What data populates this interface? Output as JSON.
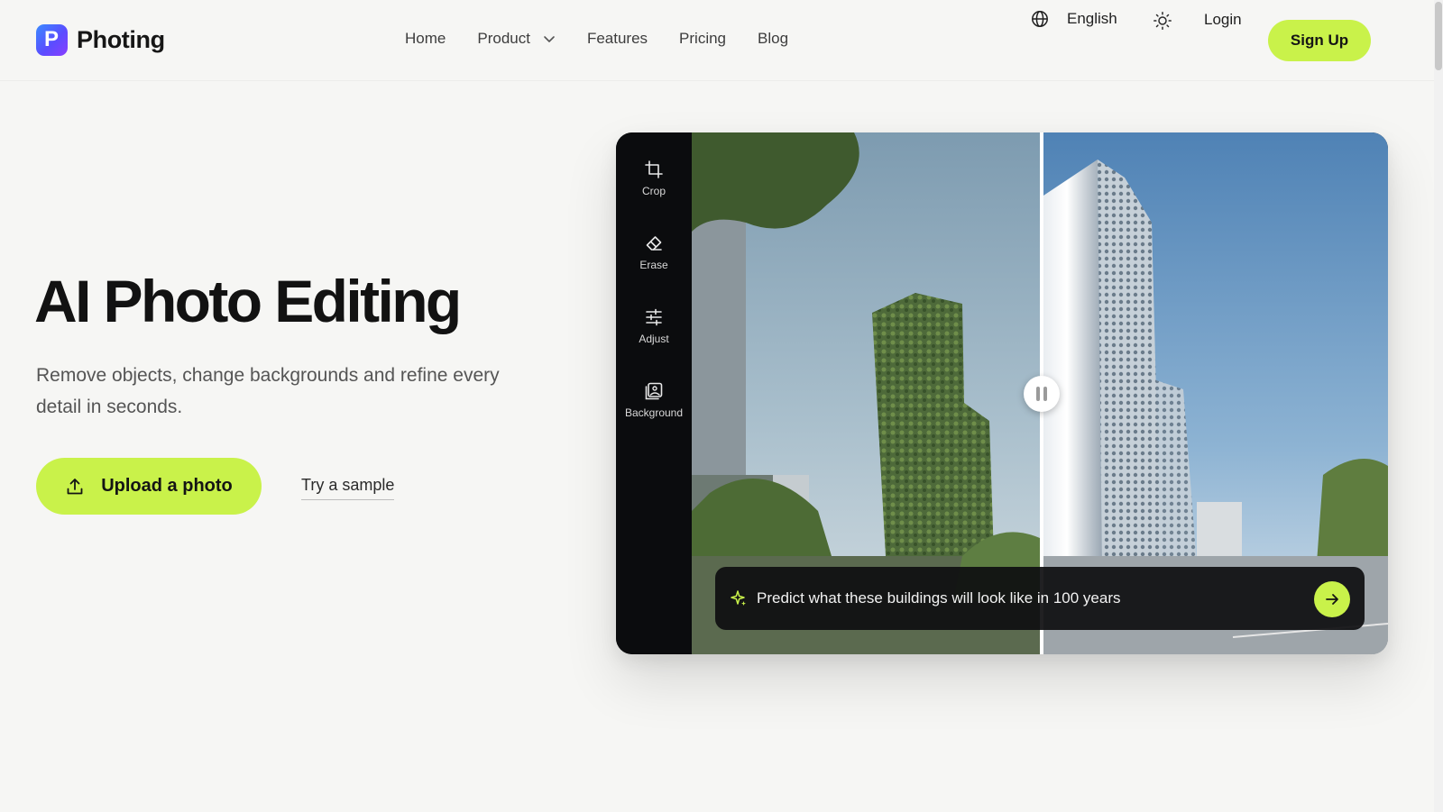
{
  "brand": {
    "name": "Photing",
    "logo_letter": "P",
    "accent": "#c9f24a"
  },
  "nav": {
    "items": [
      {
        "label": "Home"
      },
      {
        "label": "Product",
        "has_dropdown": true
      },
      {
        "label": "Features"
      },
      {
        "label": "Pricing"
      },
      {
        "label": "Blog"
      }
    ],
    "language": "English",
    "login": "Login",
    "signup": "Sign Up"
  },
  "hero": {
    "title": "AI Photo Editing",
    "subtitle": "Remove objects, change backgrounds and refine every detail in seconds.",
    "upload_label": "Upload a photo",
    "sample_label": "Try a sample"
  },
  "editor": {
    "tools": [
      {
        "label": "Crop",
        "icon": "crop-icon"
      },
      {
        "label": "Erase",
        "icon": "eraser-icon"
      },
      {
        "label": "Adjust",
        "icon": "sliders-icon"
      },
      {
        "label": "Background",
        "icon": "image-icon"
      }
    ],
    "prompt": "Predict what these buildings will look like in 100 years",
    "compare_position": 0.5
  }
}
